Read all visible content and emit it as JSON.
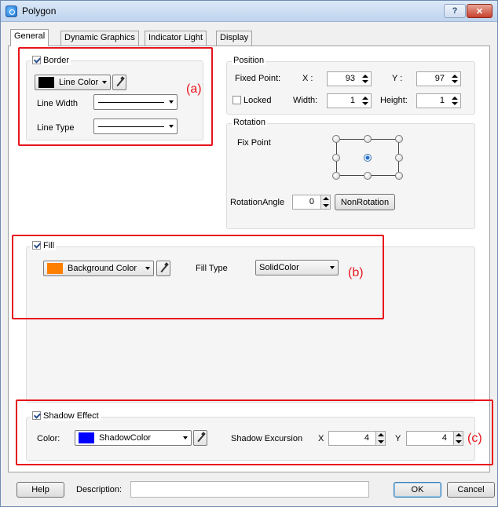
{
  "window": {
    "title": "Polygon",
    "help_button": "?",
    "close_button": "✕"
  },
  "tabs": [
    {
      "label": "General"
    },
    {
      "label": "Dynamic Graphics"
    },
    {
      "label": "Indicator Light"
    },
    {
      "label": "Display"
    }
  ],
  "border": {
    "title": "Border",
    "checked": true,
    "line_color_label": "Line Color",
    "line_color": "#000000",
    "line_width_label": "Line Width",
    "line_type_label": "Line Type"
  },
  "position": {
    "title": "Position",
    "fixed_point_label": "Fixed Point:",
    "x_label": "X :",
    "x_value": "93",
    "y_label": "Y :",
    "y_value": "97",
    "locked_label": "Locked",
    "width_label": "Width:",
    "width_value": "1",
    "height_label": "Height:",
    "height_value": "1"
  },
  "rotation": {
    "title": "Rotation",
    "fix_point_label": "Fix Point",
    "angle_label": "RotationAngle",
    "angle_value": "0",
    "non_rotation_button": "NonRotation"
  },
  "fill": {
    "title": "Fill",
    "checked": true,
    "bg_color_label": "Background Color",
    "bg_color": "#ff7f00",
    "fill_type_label": "Fill Type",
    "fill_type_value": "SolidColor"
  },
  "shadow": {
    "title": "Shadow Effect",
    "checked": true,
    "color_label": "Color:",
    "shadow_color_label": "ShadowColor",
    "shadow_color": "#0000ff",
    "excursion_label": "Shadow Excursion",
    "x_label": "X",
    "x_value": "4",
    "y_label": "Y",
    "y_value": "4"
  },
  "annotations": {
    "a": "(a)",
    "b": "(b)",
    "c": "(c)",
    "color": "#e8141c"
  },
  "footer": {
    "help_button": "Help",
    "description_label": "Description:",
    "description_value": "",
    "ok_button": "OK",
    "cancel_button": "Cancel"
  }
}
